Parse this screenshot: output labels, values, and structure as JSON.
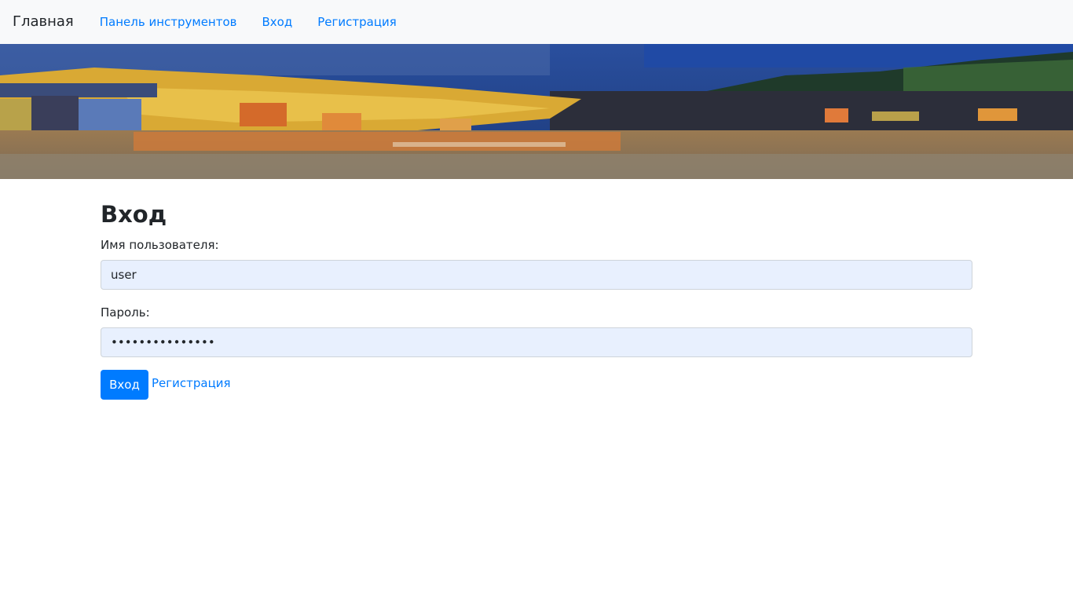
{
  "navbar": {
    "brand": "Главная",
    "links": [
      {
        "label": "Панель инструментов"
      },
      {
        "label": "Вход"
      },
      {
        "label": "Регистрация"
      }
    ]
  },
  "form": {
    "title": "Вход",
    "username_label": "Имя пользователя:",
    "username_value": "user",
    "password_label": "Пароль:",
    "password_value": "123456789012345",
    "submit_label": "Вход",
    "register_link": "Регистрация"
  },
  "colors": {
    "link": "#007bff",
    "navbar_bg": "#f8f9fa",
    "input_autofill_bg": "#e8f0fe",
    "button_bg": "#007bff"
  }
}
